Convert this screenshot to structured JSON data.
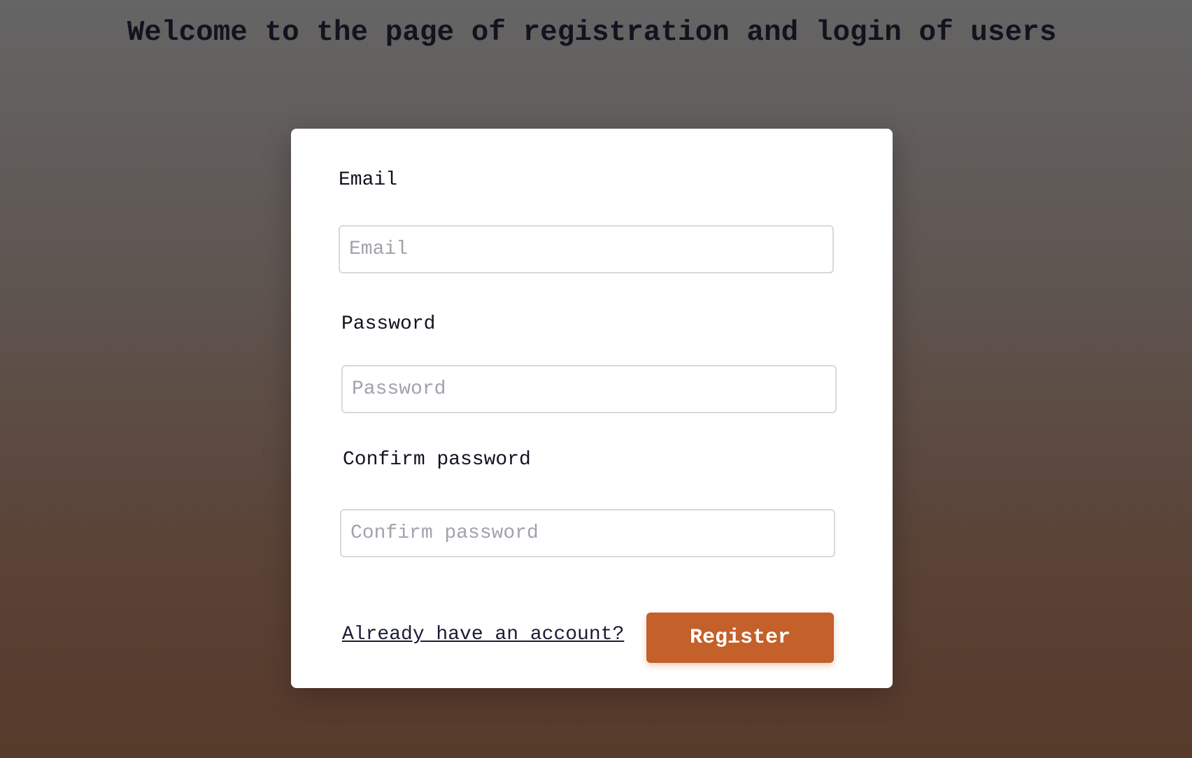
{
  "page": {
    "title": "Welcome to the page of registration and login of users"
  },
  "form": {
    "email_label": "Email",
    "email_placeholder": "Email",
    "email_value": "",
    "password_label": "Password",
    "password_placeholder": "Password",
    "password_value": "",
    "confirm_label": "Confirm password",
    "confirm_placeholder": "Confirm password",
    "confirm_value": "",
    "login_link": "Already have an account?",
    "register_button": "Register"
  },
  "colors": {
    "accent": "#c4602a",
    "text": "#12131f",
    "placeholder": "#a2a2ab"
  }
}
